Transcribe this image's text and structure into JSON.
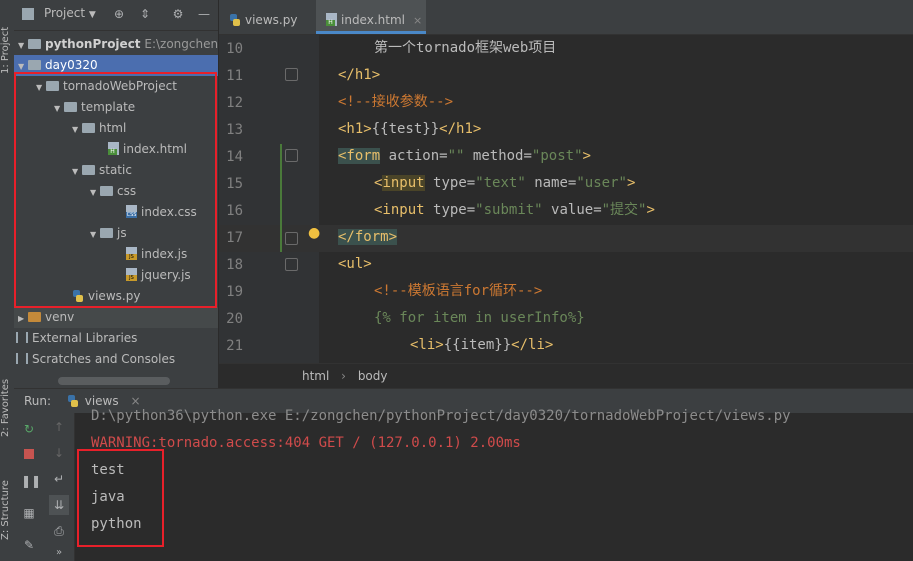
{
  "left_strip": {
    "project_tab": "1: Project",
    "favorites_tab": "2: Favorites",
    "structure_tab": "Z: Structure"
  },
  "project_panel": {
    "title": "Project",
    "tree": [
      {
        "label": "pythonProject",
        "path": "E:\\zongchen\\py"
      },
      {
        "label": "day0320"
      },
      {
        "label": "tornadoWebProject"
      },
      {
        "label": "template"
      },
      {
        "label": "html"
      },
      {
        "label": "index.html"
      },
      {
        "label": "static"
      },
      {
        "label": "css"
      },
      {
        "label": "index.css"
      },
      {
        "label": "js"
      },
      {
        "label": "index.js"
      },
      {
        "label": "jquery.js"
      },
      {
        "label": "views.py"
      },
      {
        "label": "venv"
      },
      {
        "label": "External Libraries"
      },
      {
        "label": "Scratches and Consoles"
      }
    ]
  },
  "tabs": [
    {
      "label": "views.py"
    },
    {
      "label": "index.html",
      "close": "×"
    }
  ],
  "editor": {
    "lines": [
      {
        "num": "10",
        "text": "第一个tornado框架web项目"
      },
      {
        "num": "11",
        "text": "</h1>"
      },
      {
        "num": "12",
        "text": "<!--接收参数-->"
      },
      {
        "num": "13",
        "text": "<h1>{{test}}</h1>"
      },
      {
        "num": "14",
        "text": "<form action=\"\" method=\"post\">"
      },
      {
        "num": "15",
        "text": "<input type=\"text\" name=\"user\">"
      },
      {
        "num": "16",
        "text": "<input type=\"submit\" value=\"提交\">"
      },
      {
        "num": "17",
        "text": "</form>"
      },
      {
        "num": "18",
        "text": "<ul>"
      },
      {
        "num": "19",
        "text": "<!--模板语言for循环-->"
      },
      {
        "num": "20",
        "text": "{% for item in userInfo%}"
      },
      {
        "num": "21",
        "text": "<li>{{item}}</li>"
      }
    ],
    "parts": {
      "l13_open": "<h1>",
      "l13_mid": "{{test}}",
      "l13_close": "</h1>",
      "l14_open": "<form",
      "l14_a1": "action=",
      "l14_v1": "\"\"",
      "l14_a2": "method=",
      "l14_v2": "\"post\"",
      "l14_end": ">",
      "l15_open": "<",
      "l15_tag": "input",
      "l15_a1": "type=",
      "l15_v1": "\"text\"",
      "l15_a2": "name=",
      "l15_v2": "\"user\"",
      "l15_end": ">",
      "l16_open": "<input",
      "l16_a1": "type=",
      "l16_v1": "\"submit\"",
      "l16_a2": "value=",
      "l16_v2": "\"提交\"",
      "l16_end": ">",
      "l21_open": "<li>",
      "l21_mid": "{{item}}",
      "l21_close": "</li>"
    },
    "breadcrumb": [
      "html",
      "body"
    ],
    "breadcrumb_sep": "›"
  },
  "run_panel": {
    "label": "Run:",
    "config": "views",
    "console": [
      "D:\\python36\\python.exe E:/zongchen/pythonProject/day0320/tornadoWebProject/views.py",
      "WARNING:tornado.access:404 GET / (127.0.0.1) 2.00ms",
      "test",
      "java",
      "python"
    ]
  },
  "colors": {
    "accent": "#4b6eaf",
    "highlight_box": "#e8202a",
    "warning": "#d04b4b"
  }
}
